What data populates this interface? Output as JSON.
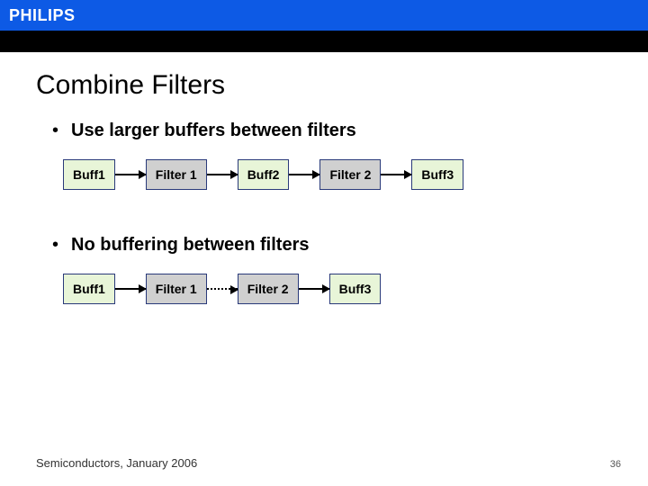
{
  "header": {
    "logo": "PHILIPS"
  },
  "title": "Combine Filters",
  "bullets": {
    "larger": "Use larger buffers between filters",
    "none": "No buffering between filters"
  },
  "diagram1": {
    "b1": "Buff1",
    "f1": "Filter 1",
    "b2": "Buff2",
    "f2": "Filter 2",
    "b3": "Buff3"
  },
  "diagram2": {
    "b1": "Buff1",
    "f1": "Filter 1",
    "f2": "Filter 2",
    "b3": "Buff3"
  },
  "footer": {
    "text": "Semiconductors, January 2006",
    "page": "36"
  }
}
